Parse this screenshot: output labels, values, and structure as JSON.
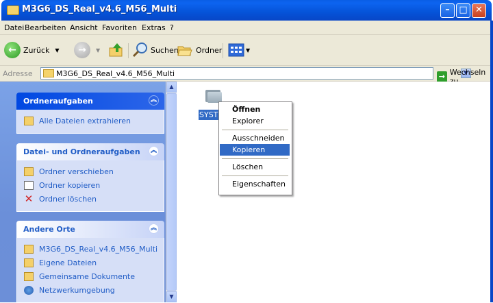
{
  "window": {
    "title": "M3G6_DS_Real_v4.6_M56_Multi",
    "min_label": "–",
    "max_label": "□",
    "close_label": "✕"
  },
  "menu": [
    "Datei",
    "Bearbeiten",
    "Ansicht",
    "Favoriten",
    "Extras",
    "?"
  ],
  "toolbar": {
    "back_label": "Zurück",
    "search_label": "Suchen",
    "folders_label": "Ordner"
  },
  "address": {
    "label": "Adresse",
    "value": "M3G6_DS_Real_v4.6_M56_Multi",
    "go_label": "Wechseln zu"
  },
  "taskpane": {
    "folder_tasks": {
      "title": "Ordneraufgaben",
      "items": [
        "Alle Dateien extrahieren"
      ]
    },
    "file_tasks": {
      "title": "Datei- und Ordneraufgaben",
      "items": [
        "Ordner verschieben",
        "Ordner kopieren",
        "Ordner löschen"
      ]
    },
    "other_places": {
      "title": "Andere Orte",
      "items": [
        "M3G6_DS_Real_v4.6_M56_Multi",
        "Eigene Dateien",
        "Gemeinsame Dokumente",
        "Netzwerkumgebung"
      ]
    }
  },
  "content": {
    "folder_label": "SYSTE"
  },
  "context_menu": {
    "items": [
      "Öffnen",
      "Explorer",
      "Ausschneiden",
      "Kopieren",
      "Löschen",
      "Eigenschaften"
    ],
    "highlighted": "Kopieren"
  },
  "colors": {
    "title_blue": "#0553d8",
    "selection": "#316ac5",
    "taskpane_bg": "#6c8fd8"
  }
}
